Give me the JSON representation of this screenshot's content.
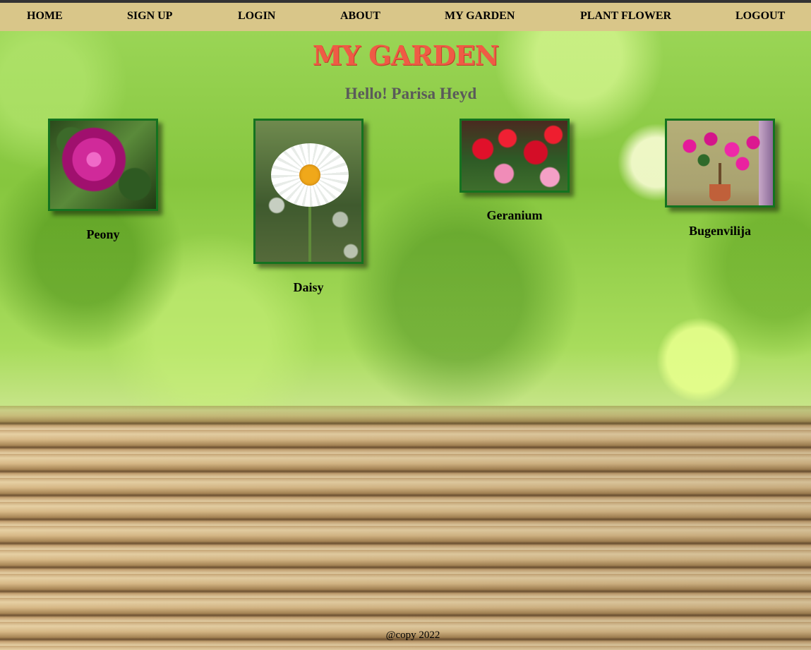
{
  "nav": {
    "items": [
      {
        "label": "HOME"
      },
      {
        "label": "SIGN UP"
      },
      {
        "label": "LOGIN"
      },
      {
        "label": "ABOUT"
      },
      {
        "label": "MY GARDEN"
      },
      {
        "label": "PLANT FLOWER"
      },
      {
        "label": "LOGOUT"
      }
    ]
  },
  "page": {
    "title": "MY GARDEN",
    "greeting": "Hello! Parisa Heyd"
  },
  "plants": [
    {
      "name": "Peony"
    },
    {
      "name": "Daisy"
    },
    {
      "name": "Geranium"
    },
    {
      "name": "Bugenvilija"
    }
  ],
  "footer": {
    "text": "@copy 2022"
  },
  "colors": {
    "nav_bg": "#d9c689",
    "title": "#ef5b45",
    "greeting": "#5a5a5a",
    "frame_border": "#14731f"
  }
}
